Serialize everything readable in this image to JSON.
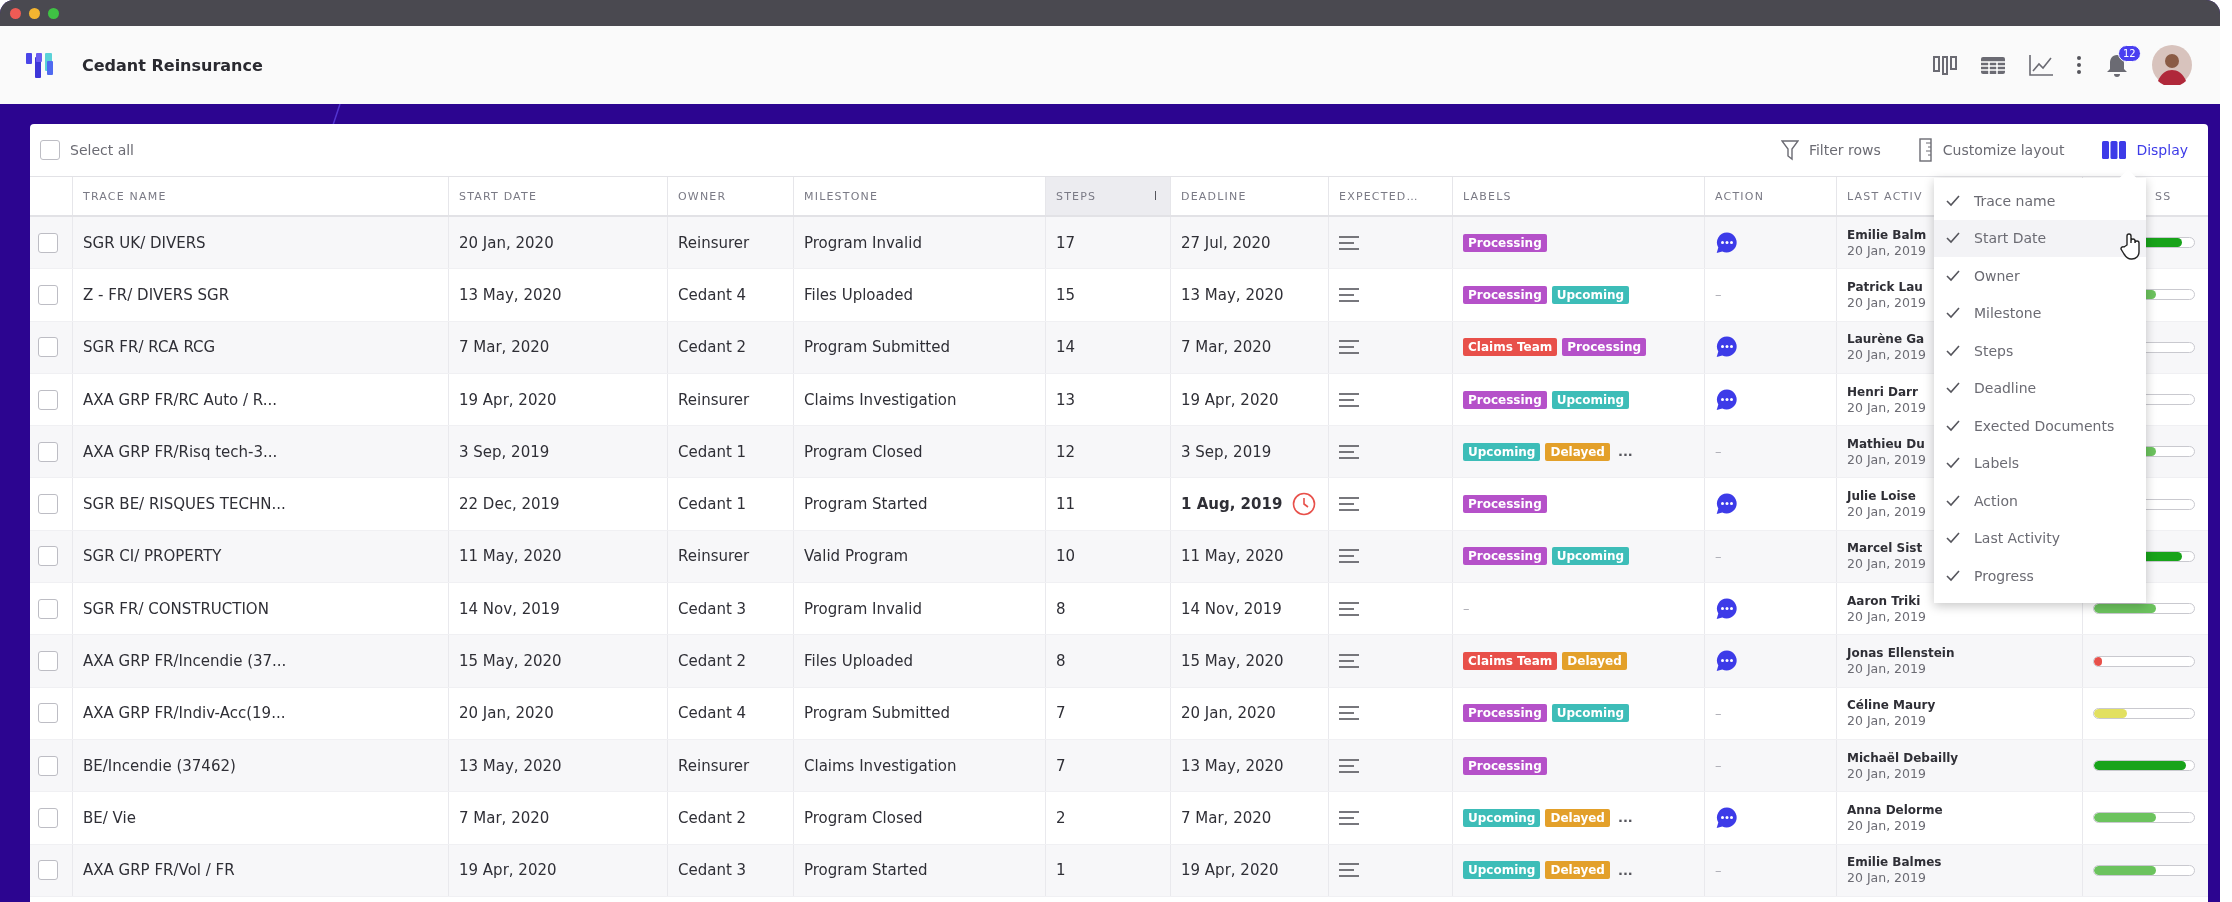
{
  "app": {
    "title": "Cedant Reinsurance",
    "notifications": "12"
  },
  "toolbar": {
    "select_all": {
      "label": "Select all",
      "checked": false
    },
    "actions": [
      {
        "label": "Filter rows",
        "kind": "filter",
        "selected": false
      },
      {
        "label": "Customize layout",
        "kind": "layout",
        "selected": false
      },
      {
        "label": "Display",
        "kind": "display",
        "selected": true
      }
    ]
  },
  "table": {
    "columns": [
      {
        "label": "TRACE NAME",
        "sorted": false
      },
      {
        "label": "START DATE",
        "sorted": false
      },
      {
        "label": "OWNER",
        "sorted": false
      },
      {
        "label": "MILESTONE",
        "sorted": false
      },
      {
        "label": "STEPS",
        "sorted": true
      },
      {
        "label": "DEADLINE",
        "sorted": false
      },
      {
        "label": "EXPECTED…",
        "sorted": false
      },
      {
        "label": "LABELS",
        "sorted": false
      },
      {
        "label": "ACTION",
        "sorted": false
      },
      {
        "label": "LAST ACTIV",
        "sorted": false
      },
      {
        "label": "SS",
        "sorted": false
      }
    ],
    "rows": [
      {
        "checked": false,
        "trace_name": "SGR UK/ DIVERS",
        "start_date": "20 Jan, 2020",
        "owner": "Reinsurer",
        "milestone": "Program Invalid",
        "steps": "17",
        "deadline": "27 Jul, 2020",
        "overdue": false,
        "labels": [
          {
            "text": "Processing",
            "color": "#b551c9"
          }
        ],
        "action": {
          "kind": "chat"
        },
        "last_activity": {
          "name": "Emilie Balm",
          "date": "20 Jan, 2019"
        },
        "progress": {
          "level": 0.88,
          "color": "#18a31a"
        }
      },
      {
        "checked": false,
        "trace_name": "Z - FR/ DIVERS SGR",
        "start_date": "13 May, 2020",
        "owner": "Cedant 4",
        "milestone": "Files Uploaded",
        "steps": "15",
        "deadline": "13 May, 2020",
        "overdue": false,
        "labels": [
          {
            "text": "Processing",
            "color": "#b551c9"
          },
          {
            "text": "Upcoming",
            "color": "#3dbdb8"
          }
        ],
        "action": {
          "kind": "none",
          "text": "–"
        },
        "last_activity": {
          "name": "Patrick Lau",
          "date": "20 Jan, 2019"
        },
        "progress": {
          "level": 0.62,
          "color": "#6cc35e"
        }
      },
      {
        "checked": false,
        "trace_name": "SGR FR/ RCA RCG",
        "start_date": "7 Mar, 2020",
        "owner": "Cedant 2",
        "milestone": "Program Submitted",
        "steps": "14",
        "deadline": "7 Mar, 2020",
        "overdue": false,
        "labels": [
          {
            "text": "Claims Team",
            "color": "#e8504a"
          },
          {
            "text": "Processing",
            "color": "#b551c9"
          }
        ],
        "action": {
          "kind": "chat"
        },
        "last_activity": {
          "name": "Laurène Ga",
          "date": "20 Jan, 2019"
        }
      },
      {
        "checked": false,
        "trace_name": "AXA GRP FR/RC Auto / R...",
        "start_date": "19 Apr, 2020",
        "owner": "Reinsurer",
        "milestone": "Claims Investigation",
        "steps": "13",
        "deadline": "19 Apr, 2020",
        "overdue": false,
        "labels": [
          {
            "text": "Processing",
            "color": "#b551c9"
          },
          {
            "text": "Upcoming",
            "color": "#3dbdb8"
          }
        ],
        "action": {
          "kind": "chat"
        },
        "last_activity": {
          "name": "Henri Darr",
          "date": "20 Jan, 2019"
        }
      },
      {
        "checked": false,
        "trace_name": "AXA GRP FR/Risq tech-3...",
        "start_date": "3 Sep, 2019",
        "owner": "Cedant 1",
        "milestone": "Program Closed",
        "steps": "12",
        "deadline": "3 Sep, 2019",
        "overdue": false,
        "labels": [
          {
            "text": "Upcoming",
            "color": "#3dbdb8"
          },
          {
            "text": "Delayed",
            "color": "#e3a02a"
          }
        ],
        "more_labels": "...",
        "action": {
          "kind": "none",
          "text": "–"
        },
        "last_activity": {
          "name": "Mathieu Du",
          "date": "20 Jan, 2019"
        },
        "progress": {
          "level": 0.62,
          "color": "#6cc35e"
        }
      },
      {
        "checked": false,
        "trace_name": "SGR BE/ RISQUES TECHN...",
        "start_date": "22 Dec, 2019",
        "owner": "Cedant 1",
        "milestone": "Program Started",
        "steps": "11",
        "deadline": "1 Aug, 2019",
        "overdue": true,
        "labels": [
          {
            "text": "Processing",
            "color": "#b551c9"
          }
        ],
        "action": {
          "kind": "chat"
        },
        "last_activity": {
          "name": "Julie Loise",
          "date": "20 Jan, 2019"
        }
      },
      {
        "checked": false,
        "trace_name": "SGR CI/ PROPERTY",
        "start_date": "11 May, 2020",
        "owner": "Reinsurer",
        "milestone": "Valid Program",
        "steps": "10",
        "deadline": "11 May, 2020",
        "overdue": false,
        "labels": [
          {
            "text": "Processing",
            "color": "#b551c9"
          },
          {
            "text": "Upcoming",
            "color": "#3dbdb8"
          }
        ],
        "action": {
          "kind": "none",
          "text": "–"
        },
        "last_activity": {
          "name": "Marcel Sist",
          "date": "20 Jan, 2019"
        },
        "progress": {
          "level": 0.88,
          "color": "#18a31a"
        }
      },
      {
        "checked": false,
        "trace_name": "SGR FR/ CONSTRUCTION",
        "start_date": "14 Nov, 2019",
        "owner": "Cedant 3",
        "milestone": "Program Invalid",
        "steps": "8",
        "deadline": "14 Nov, 2019",
        "overdue": false,
        "labels_text": "–",
        "action": {
          "kind": "chat"
        },
        "last_activity": {
          "name": "Aaron Triki",
          "date": "20 Jan, 2019"
        },
        "progress": {
          "level": 0.62,
          "color": "#6cc35e"
        }
      },
      {
        "checked": false,
        "trace_name": "AXA GRP FR/Incendie (37...",
        "start_date": "15 May, 2020",
        "owner": "Cedant 2",
        "milestone": "Files Uploaded",
        "steps": "8",
        "deadline": "15 May, 2020",
        "overdue": false,
        "labels": [
          {
            "text": "Claims Team",
            "color": "#e8504a"
          },
          {
            "text": "Delayed",
            "color": "#e3a02a"
          }
        ],
        "action": {
          "kind": "chat"
        },
        "last_activity": {
          "name": "Jonas Ellenstein",
          "date": "20 Jan, 2019"
        },
        "progress": {
          "level": 0.08,
          "color": "#e8504a"
        }
      },
      {
        "checked": false,
        "trace_name": "AXA GRP FR/Indiv-Acc(19...",
        "start_date": "20 Jan, 2020",
        "owner": "Cedant 4",
        "milestone": "Program Submitted",
        "steps": "7",
        "deadline": "20 Jan, 2020",
        "overdue": false,
        "labels": [
          {
            "text": "Processing",
            "color": "#b551c9"
          },
          {
            "text": "Upcoming",
            "color": "#3dbdb8"
          }
        ],
        "action": {
          "kind": "none",
          "text": "–"
        },
        "last_activity": {
          "name": "Céline Maury",
          "date": "20 Jan, 2019"
        },
        "progress": {
          "level": 0.33,
          "color": "#e2e060"
        }
      },
      {
        "checked": false,
        "trace_name": "BE/Incendie (37462)",
        "start_date": "13 May, 2020",
        "owner": "Reinsurer",
        "milestone": "Claims Investigation",
        "steps": "7",
        "deadline": "13 May, 2020",
        "overdue": false,
        "labels": [
          {
            "text": "Processing",
            "color": "#b551c9"
          }
        ],
        "action": {
          "kind": "none",
          "text": "–"
        },
        "last_activity": {
          "name": "Michaël Debailly",
          "date": "20 Jan, 2019"
        },
        "progress": {
          "level": 0.92,
          "color": "#18a31a"
        }
      },
      {
        "checked": false,
        "trace_name": "BE/ Vie",
        "start_date": "7 Mar, 2020",
        "owner": "Cedant 2",
        "milestone": "Program Closed",
        "steps": "2",
        "deadline": "7 Mar, 2020",
        "overdue": false,
        "labels": [
          {
            "text": "Upcoming",
            "color": "#3dbdb8"
          },
          {
            "text": "Delayed",
            "color": "#e3a02a"
          }
        ],
        "more_labels": "...",
        "action": {
          "kind": "chat"
        },
        "last_activity": {
          "name": "Anna Delorme",
          "date": "20 Jan, 2019"
        },
        "progress": {
          "level": 0.62,
          "color": "#6cc35e"
        }
      },
      {
        "checked": false,
        "trace_name": "AXA GRP FR/Vol / FR",
        "start_date": "19 Apr, 2020",
        "owner": "Cedant 3",
        "milestone": "Program Started",
        "steps": "1",
        "deadline": "19 Apr, 2020",
        "overdue": false,
        "labels": [
          {
            "text": "Upcoming",
            "color": "#3dbdb8"
          },
          {
            "text": "Delayed",
            "color": "#e3a02a"
          }
        ],
        "more_labels": "...",
        "action": {
          "kind": "none",
          "text": "–"
        },
        "last_activity": {
          "name": "Emilie Balmes",
          "date": "20 Jan, 2019"
        },
        "progress": {
          "level": 0.62,
          "color": "#6cc35e"
        }
      }
    ]
  },
  "display_menu": {
    "items": [
      {
        "label": "Trace name",
        "checked": true,
        "selected": false
      },
      {
        "label": "Start Date",
        "checked": true,
        "selected": true
      },
      {
        "label": "Owner",
        "checked": true,
        "selected": false
      },
      {
        "label": "Milestone",
        "checked": true,
        "selected": false
      },
      {
        "label": "Steps",
        "checked": true,
        "selected": false
      },
      {
        "label": "Deadline",
        "checked": true,
        "selected": false
      },
      {
        "label": "Exected Documents",
        "checked": true,
        "selected": false
      },
      {
        "label": "Labels",
        "checked": true,
        "selected": false
      },
      {
        "label": "Action",
        "checked": true,
        "selected": false
      },
      {
        "label": "Last Activity",
        "checked": true,
        "selected": false
      },
      {
        "label": "Progress",
        "checked": true,
        "selected": false
      }
    ]
  }
}
